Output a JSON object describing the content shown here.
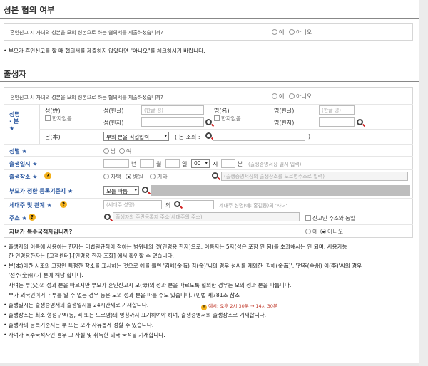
{
  "section1": {
    "title": "성본 협의 여부",
    "question": "혼인신고 시 자녀의 성본을 모의 성본으로 하는 협의서를 제출하셨습니까?",
    "opt_yes": "예",
    "opt_no": "아니오",
    "note": "부모가 혼인신고를 할 때 협의서를 제출하지 않았다면 \"아니오\"를 체크하시기 바랍니다."
  },
  "section2": {
    "title": "출생자",
    "question": "혼인신고 시 자녀의 성본을 모의 성본으로 하는 협의서를 제출하셨습니까?",
    "opt_yes": "예",
    "opt_no": "아니오",
    "name_label": "성명 · 본",
    "surname_label": "성(姓)",
    "no_hanja": "한자없음",
    "surname_hangul_label": "성(한글)",
    "surname_hangul_placeholder": "(한글 성)",
    "surname_hanja_label": "성(한자)",
    "given_label": "명(名)",
    "given_hangul_label": "명(한글)",
    "given_hangul_placeholder": "(한글 명)",
    "given_hanja_label": "명(한자)",
    "bon_label": "본(本)",
    "bon_select": "부의 본을 직접입력",
    "bon_lookup": "( 본 조회 :",
    "sex_label": "성별",
    "sex_male": "남",
    "sex_female": "여",
    "birth_label": "출생일시",
    "u_year": "년",
    "u_month": "월",
    "u_day": "일",
    "u_hour": "시",
    "u_min": "분",
    "hour_value": "00",
    "birth_hint": "(출생증명서상 일시 입력)",
    "place_label": "출생장소",
    "place_home": "자택",
    "place_hospital": "병원",
    "place_other": "기타",
    "place_placeholder": "(출생증명서상의 출생장소를 도로명주소로 입력)",
    "parent_label": "부모가 정한 등록기준지",
    "parent_select": "모를 따름",
    "head_label": "세대주 및 관계",
    "head_placeholder": "(세대주 성명)",
    "head_of": "의",
    "head_hint": "세대주 성명(예: 홍길동)의 '자녀'",
    "addr_label": "주소",
    "addr_placeholder": "출생자의 주민등록지 주소(세대주의 주소)",
    "addr_check": "신고인 주소와 동일",
    "multi_label": "자녀가 복수국적자입니까?",
    "multi_yes": "예",
    "multi_no": "아니오"
  },
  "notes": [
    "출생자의 이름에 사용하는 한자는 대법원규칙이 정하는 범위내의 것(인명용 한자)으로, 이름자는 5자(성은 포함 안 됨)를 초과해서는 안 되며, 사용가능",
    "한 인명용한자는 [고객센터]-[인명용 한자 조회] 에서 확인할 수 있습니다.",
    "본(本)이란 시조의 고향인 특정한 장소를 표시하는 것으로 예를 들면 '김해(金海) 김(金)'씨의 경우 성씨를 제외한 '김해(金海)', '전주(全州) 이(李)'씨의 경우",
    "'전주(全州)'가 본에 해당 합니다.",
    "자녀는 부(父)의 성과 본을 따르지만 부모가 혼인신고시 모(母)의 성과 본을 따르도록 협의한 경우는 모의 성과 본을 따릅니다.",
    "부가 외국인이거나 부를 알 수 없는 경우 등은 모의 성과 본을 따를 수도 있습니다. (민법 제781조 참조",
    "출생일시는 출생증명서의 출생일시를 24시간제로 기재합니다.",
    "출생장소는 최소 행정구역(동, 리 또는 도로명)의 명칭까지 표기하여야 하며, 출생증명서의 출생장소로 기재합니다.",
    "출생자의 등록기준지는 부 또는 모가 자유롭게 정할 수 있습니다.",
    "자녀가 복수국적자인 경우 그 사실 및 취득한 외국 국적을 기재합니다."
  ],
  "time_example": "예시: 오후 2시 30분 → 14시 30분"
}
